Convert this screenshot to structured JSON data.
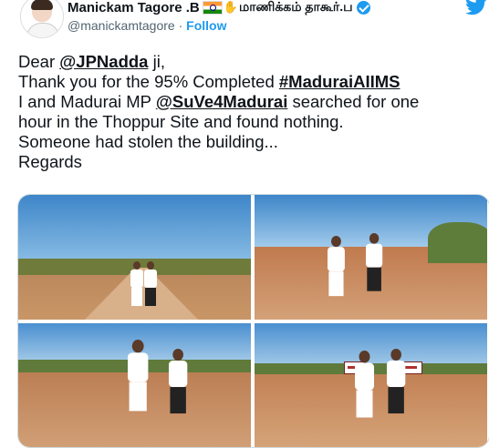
{
  "author": {
    "display_name": "Manickam Tagore .B",
    "name_suffix_emoji": "✋",
    "tamil_name": "மாணிக்கம் தாகூர்.ப",
    "handle": "@manickamtagore",
    "separator": "·",
    "follow_label": "Follow"
  },
  "tweet": {
    "line1_prefix": "Dear ",
    "line1_mention": "@JPNadda",
    "line1_suffix": " ji,",
    "line2_prefix": "Thank you for the 95% Completed ",
    "line2_hashtag": "#MaduraiAIIMS",
    "line3_prefix": "I and Madurai MP ",
    "line3_mention": "@SuVe4Madurai",
    "line3_suffix": " searched for one",
    "line4": "hour in the Thoppur Site and found nothing.",
    "line5": "Someone had stolen the building...",
    "line6": "Regards"
  },
  "icons": {
    "verified": "verified-badge-icon",
    "brand": "twitter-bird-icon",
    "flag": "india-flag-icon"
  },
  "colors": {
    "accent": "#1d9bf0",
    "text": "#0f1419",
    "secondary": "#536471",
    "border": "#cfd9de"
  },
  "media": {
    "photo_count": 4
  }
}
